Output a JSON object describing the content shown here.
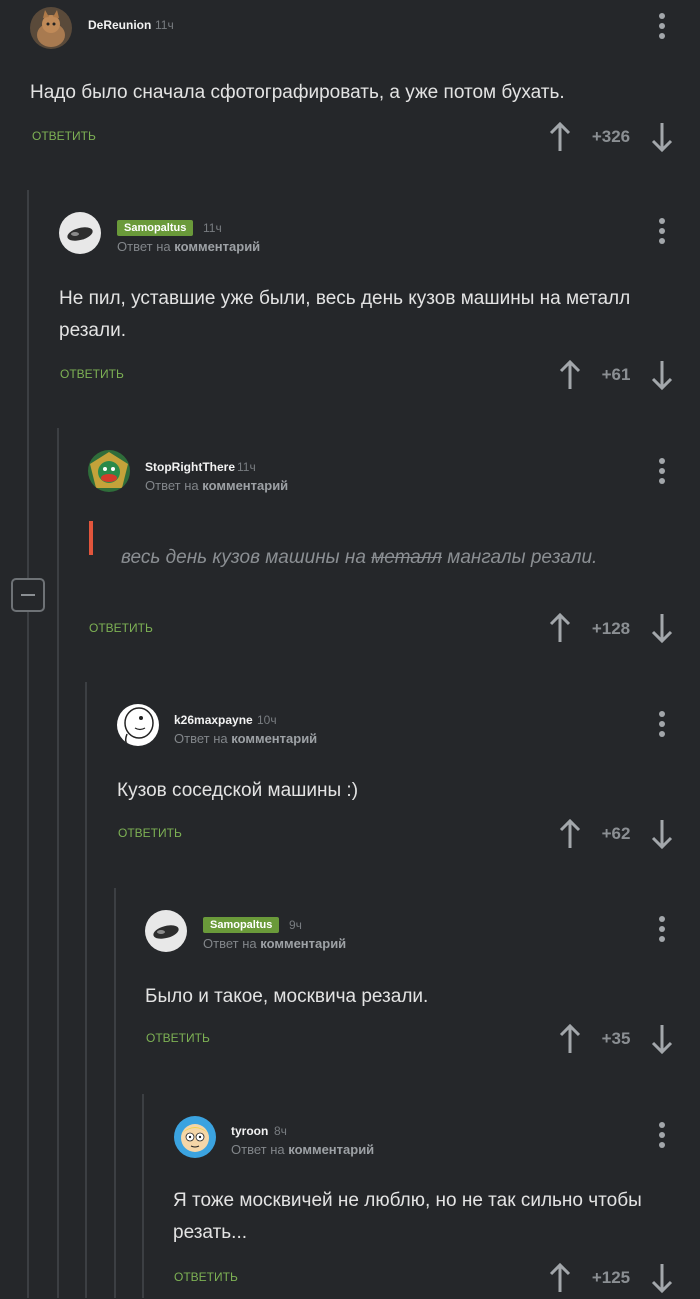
{
  "comments": [
    {
      "username": "DeReunion",
      "badge": false,
      "time": "11ч",
      "text": "Надо было сначала сфотографировать, а уже потом бухать.",
      "reply_label": "ОТВЕТИТЬ",
      "score": "+326"
    },
    {
      "username": "Samopaltus",
      "badge": true,
      "time": "11ч",
      "reply_prefix": "Ответ на",
      "reply_target": "комментарий",
      "text": "Не пил, уставшие уже были, весь день кузов машины на металл резали.",
      "reply_label": "ОТВЕТИТЬ",
      "score": "+61"
    },
    {
      "username": "StopRightThere",
      "badge": false,
      "time": "11ч",
      "reply_prefix": "Ответ на",
      "reply_target": "комментарий",
      "quote_before": "весь день кузов машины на",
      "quote_struck": "металл",
      "quote_after": "мангалы резали.",
      "reply_label": "ОТВЕТИТЬ",
      "score": "+128"
    },
    {
      "username": "k26maxpayne",
      "badge": false,
      "time": "10ч",
      "reply_prefix": "Ответ на",
      "reply_target": "комментарий",
      "text": "Кузов соседской машины :)",
      "reply_label": "ОТВЕТИТЬ",
      "score": "+62"
    },
    {
      "username": "Samopaltus",
      "badge": true,
      "time": "9ч",
      "reply_prefix": "Ответ на",
      "reply_target": "комментарий",
      "text": "Было и такое, москвича резали.",
      "reply_label": "ОТВЕТИТЬ",
      "score": "+35"
    },
    {
      "username": "tyroon",
      "badge": false,
      "time": "8ч",
      "reply_prefix": "Ответ на",
      "reply_target": "комментарий",
      "text": "Я тоже москвичей не люблю, но не так сильно чтобы резать...",
      "reply_label": "ОТВЕТИТЬ",
      "score": "+125"
    }
  ],
  "icons": {
    "upvote": "arrow-up-icon",
    "downvote": "arrow-down-icon",
    "menu": "more-vertical-icon",
    "collapse": "minus-square-icon"
  },
  "colors": {
    "background": "#25272a",
    "accent_green": "#7db154",
    "badge_green": "#6a9a3a",
    "quote_bar": "#e2553c"
  }
}
